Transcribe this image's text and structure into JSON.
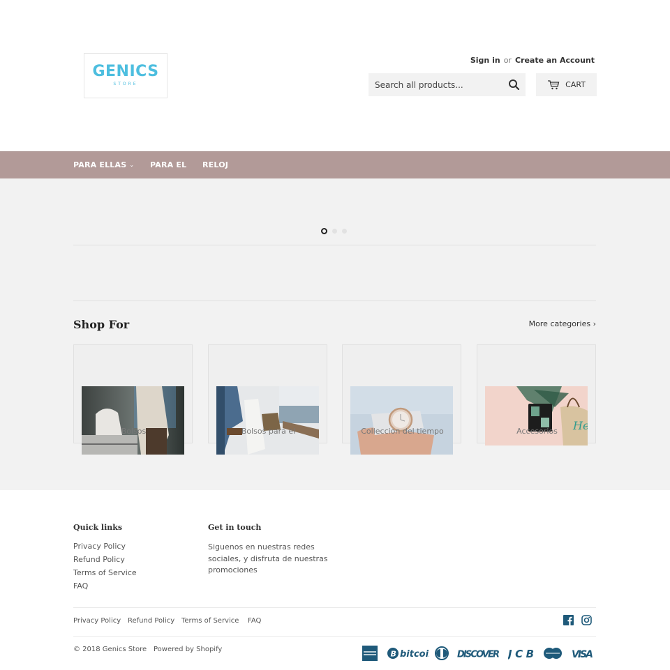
{
  "header": {
    "logo": {
      "name": "GENICS",
      "tagline": "STORE"
    },
    "account": {
      "sign_in": "Sign in",
      "or": "or",
      "create": "Create an Account"
    },
    "search": {
      "placeholder": "Search all products...",
      "value": ""
    },
    "cart_label": "CART"
  },
  "nav": {
    "items": [
      {
        "label": "PARA ELLAS",
        "has_dropdown": true
      },
      {
        "label": "PARA EL",
        "has_dropdown": false
      },
      {
        "label": "RELOJ",
        "has_dropdown": false
      }
    ],
    "bg_color": "#b29a98"
  },
  "slideshow": {
    "slides": 3,
    "active_index": 0
  },
  "shop_for": {
    "title": "Shop For",
    "more_link": "More categories ›",
    "categories": [
      {
        "label": "Bolsos"
      },
      {
        "label": "Bolsos para el"
      },
      {
        "label": "Colleccion del tiempo"
      },
      {
        "label": "Accesorios"
      }
    ]
  },
  "footer": {
    "quick_links": {
      "title": "Quick links",
      "items": [
        "Privacy Policy",
        "Refund Policy",
        "Terms of Service",
        "FAQ"
      ]
    },
    "get_in_touch": {
      "title": "Get in touch",
      "text": "Siguenos en nuestras redes sociales, y disfruta de nuestras promociones"
    },
    "bottom_links": [
      "Privacy Policy",
      "Refund Policy",
      "Terms of Service",
      "FAQ"
    ],
    "social": [
      "facebook",
      "instagram"
    ],
    "copyright": "© 2018 Genics Store",
    "powered_by": "Powered by Shopify",
    "payment_methods": [
      "American Express",
      "bitcoin",
      "Diners Club",
      "DISCOVER",
      "JCB",
      "MasterCard",
      "VISA"
    ],
    "icon_color": "#1f5a7a"
  }
}
